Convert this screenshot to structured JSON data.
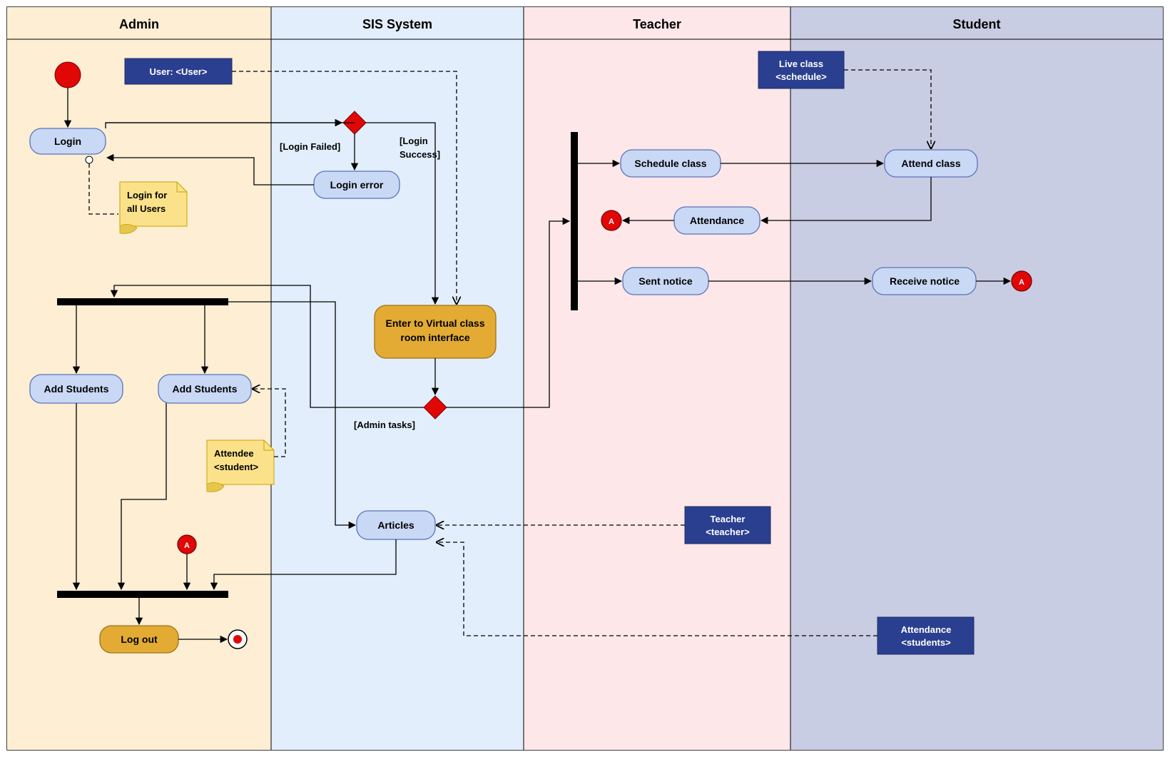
{
  "lanes": {
    "admin": "Admin",
    "sis": "SIS System",
    "teacher": "Teacher",
    "student": "Student"
  },
  "nodes": {
    "login": "Login",
    "loginError": "Login error",
    "addStudents1": "Add Students",
    "addStudents2": "Add Students",
    "logout": "Log out",
    "enterVCR_l1": "Enter to Virtual class",
    "enterVCR_l2": "room interface",
    "articles": "Articles",
    "scheduleClass": "Schedule class",
    "attendance": "Attendance",
    "sentNotice": "Sent notice",
    "attendClass": "Attend class",
    "receiveNotice": "Receive notice"
  },
  "objects": {
    "user": "User: <User>",
    "liveClass_l1": "Live class",
    "liveClass_l2": "<schedule>",
    "teacher_l1": "Teacher",
    "teacher_l2": "<teacher>",
    "attStud_l1": "Attendance",
    "attStud_l2": "<students>"
  },
  "notes": {
    "loginAll_l1": "Login for",
    "loginAll_l2": "all Users",
    "attendee_l1": "Attendee",
    "attendee_l2": "<student>"
  },
  "guards": {
    "loginFailed": "[Login Failed]",
    "loginSuccess_l1": "[Login",
    "loginSuccess_l2": "Success]",
    "adminTasks": "[Admin tasks]"
  },
  "connector": "A",
  "chart_data": {
    "type": "table",
    "diagram_type": "UML Activity Diagram with Swimlanes",
    "swimlanes": [
      "Admin",
      "SIS System",
      "Teacher",
      "Student"
    ],
    "nodes": [
      {
        "id": "start",
        "type": "initial",
        "lane": "Admin"
      },
      {
        "id": "login",
        "type": "activity",
        "lane": "Admin",
        "label": "Login"
      },
      {
        "id": "userObj",
        "type": "object",
        "lane": "Admin",
        "label": "User: <User>"
      },
      {
        "id": "noteLogin",
        "type": "note",
        "lane": "Admin",
        "label": "Login for all Users"
      },
      {
        "id": "d1",
        "type": "decision",
        "lane": "SIS System"
      },
      {
        "id": "loginError",
        "type": "activity",
        "lane": "SIS System",
        "label": "Login error"
      },
      {
        "id": "enterVCR",
        "type": "activity",
        "lane": "SIS System",
        "label": "Enter to Virtual class room interface",
        "highlight": true
      },
      {
        "id": "d2",
        "type": "decision",
        "lane": "SIS System"
      },
      {
        "id": "fork1",
        "type": "fork",
        "lane": "Admin"
      },
      {
        "id": "addStudents1",
        "type": "activity",
        "lane": "Admin",
        "label": "Add Students"
      },
      {
        "id": "addStudents2",
        "type": "activity",
        "lane": "Admin",
        "label": "Add Students"
      },
      {
        "id": "noteAttendee",
        "type": "note",
        "lane": "Admin",
        "label": "Attendee <student>"
      },
      {
        "id": "connA_in",
        "type": "connector",
        "lane": "Admin",
        "label": "A"
      },
      {
        "id": "join1",
        "type": "join",
        "lane": "Admin"
      },
      {
        "id": "logout",
        "type": "activity",
        "lane": "Admin",
        "label": "Log out",
        "highlight": true
      },
      {
        "id": "end",
        "type": "final",
        "lane": "Admin"
      },
      {
        "id": "articles",
        "type": "activity",
        "lane": "SIS System",
        "label": "Articles"
      },
      {
        "id": "teacherObj",
        "type": "object",
        "lane": "Teacher",
        "label": "Teacher <teacher>"
      },
      {
        "id": "attStudObj",
        "type": "object",
        "lane": "Student",
        "label": "Attendance <students>"
      },
      {
        "id": "fork2",
        "type": "fork",
        "lane": "Teacher"
      },
      {
        "id": "scheduleClass",
        "type": "activity",
        "lane": "Teacher",
        "label": "Schedule class"
      },
      {
        "id": "attendance",
        "type": "activity",
        "lane": "Teacher",
        "label": "Attendance"
      },
      {
        "id": "sentNotice",
        "type": "activity",
        "lane": "Teacher",
        "label": "Sent notice"
      },
      {
        "id": "liveClassObj",
        "type": "object",
        "lane": "Teacher",
        "label": "Live class <schedule>"
      },
      {
        "id": "attendClass",
        "type": "activity",
        "lane": "Student",
        "label": "Attend class"
      },
      {
        "id": "receiveNotice",
        "type": "activity",
        "lane": "Student",
        "label": "Receive notice"
      },
      {
        "id": "connA_out1",
        "type": "connector",
        "lane": "Teacher",
        "label": "A"
      },
      {
        "id": "connA_out2",
        "type": "connector",
        "lane": "Student",
        "label": "A"
      }
    ],
    "edges": [
      {
        "from": "start",
        "to": "login"
      },
      {
        "from": "login",
        "to": "d1"
      },
      {
        "from": "d1",
        "to": "loginError",
        "guard": "[Login Failed]"
      },
      {
        "from": "d1",
        "to": "enterVCR",
        "guard": "[Login Success]"
      },
      {
        "from": "loginError",
        "to": "login"
      },
      {
        "from": "userObj",
        "to": "enterVCR",
        "style": "dashed"
      },
      {
        "from": "noteLogin",
        "to": "login",
        "style": "dashed"
      },
      {
        "from": "enterVCR",
        "to": "d2"
      },
      {
        "from": "d2",
        "to": "fork1",
        "guard": "[Admin tasks]"
      },
      {
        "from": "d2",
        "to": "fork2"
      },
      {
        "from": "fork1",
        "to": "addStudents1"
      },
      {
        "from": "fork1",
        "to": "addStudents2"
      },
      {
        "from": "fork1",
        "to": "articles"
      },
      {
        "from": "noteAttendee",
        "to": "addStudents2",
        "style": "dashed"
      },
      {
        "from": "addStudents1",
        "to": "join1"
      },
      {
        "from": "addStudents2",
        "to": "join1"
      },
      {
        "from": "connA_in",
        "to": "join1"
      },
      {
        "from": "articles",
        "to": "join1"
      },
      {
        "from": "join1",
        "to": "logout"
      },
      {
        "from": "logout",
        "to": "end"
      },
      {
        "from": "teacherObj",
        "to": "articles",
        "style": "dashed"
      },
      {
        "from": "attStudObj",
        "to": "articles",
        "style": "dashed"
      },
      {
        "from": "fork2",
        "to": "scheduleClass"
      },
      {
        "from": "fork2",
        "to": "attendance"
      },
      {
        "from": "fork2",
        "to": "sentNotice"
      },
      {
        "from": "scheduleClass",
        "to": "attendClass"
      },
      {
        "from": "liveClassObj",
        "to": "attendClass",
        "style": "dashed"
      },
      {
        "from": "attendClass",
        "to": "attendance"
      },
      {
        "from": "attendance",
        "to": "connA_out1"
      },
      {
        "from": "sentNotice",
        "to": "receiveNotice"
      },
      {
        "from": "receiveNotice",
        "to": "connA_out2"
      }
    ]
  }
}
